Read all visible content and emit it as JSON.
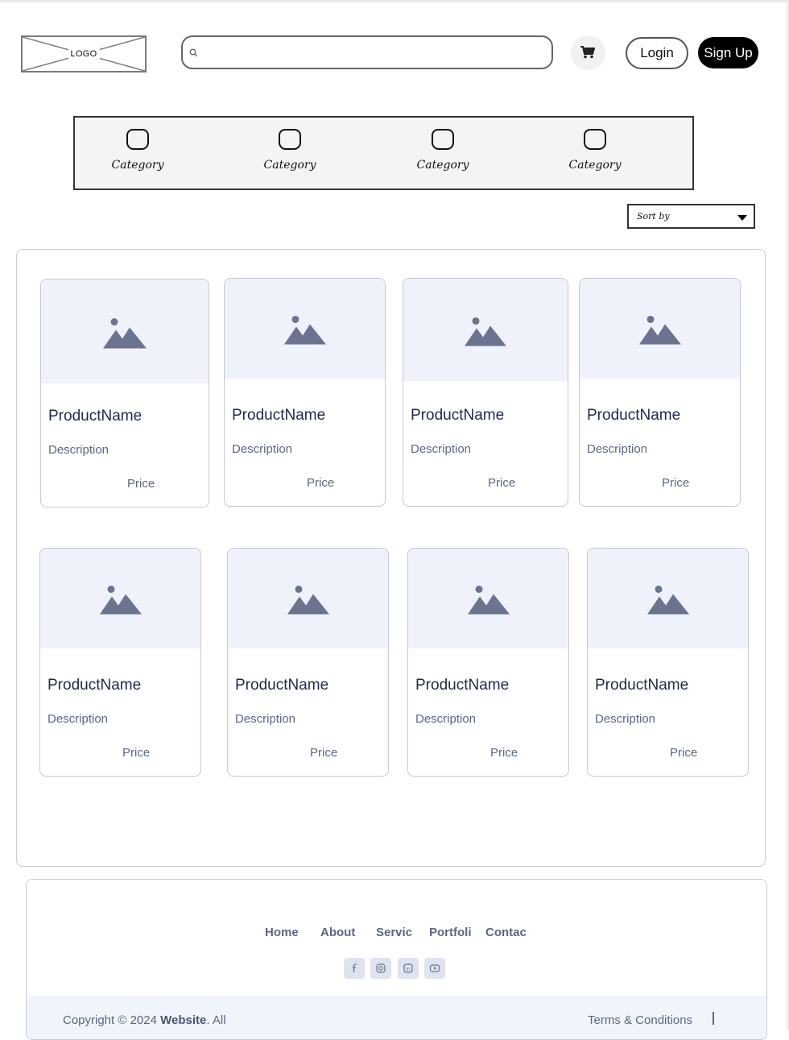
{
  "header": {
    "logo_text": "LOGO",
    "search_placeholder": "",
    "search_value": "",
    "cart_icon": "cart-icon",
    "login_label": "Login",
    "signup_label": "Sign Up"
  },
  "categories": [
    {
      "label": "Category",
      "icon": "category-icon"
    },
    {
      "label": "Category",
      "icon": "category-icon"
    },
    {
      "label": "Category",
      "icon": "category-icon"
    },
    {
      "label": "Category",
      "icon": "category-icon"
    }
  ],
  "sort": {
    "label": "Sort by"
  },
  "products": [
    {
      "name": "ProductName",
      "description": "Description",
      "price": "Price"
    },
    {
      "name": "ProductName",
      "description": "Description",
      "price": "Price"
    },
    {
      "name": "ProductName",
      "description": "Description",
      "price": "Price"
    },
    {
      "name": "ProductName",
      "description": "Description",
      "price": "Price"
    },
    {
      "name": "ProductName",
      "description": "Description",
      "price": "Price"
    },
    {
      "name": "ProductName",
      "description": "Description",
      "price": "Price"
    },
    {
      "name": "ProductName",
      "description": "Description",
      "price": "Price"
    },
    {
      "name": "ProductName",
      "description": "Description",
      "price": "Price"
    }
  ],
  "footer": {
    "nav": [
      "Home",
      "About",
      "Servic",
      "Portfoli",
      "Contac"
    ],
    "social_icons": [
      "facebook-icon",
      "instagram-icon",
      "linkedin-icon",
      "youtube-icon"
    ],
    "copyright_prefix": "Copyright © 2024 ",
    "copyright_site": "Website",
    "copyright_suffix": ". All",
    "terms_label": "Terms & Conditions"
  },
  "colors": {
    "signup_bg": "#000000",
    "card_image_bg": "#eff2fa",
    "footer_bar_bg": "#f1f4fb",
    "text_muted": "#5d6680"
  }
}
